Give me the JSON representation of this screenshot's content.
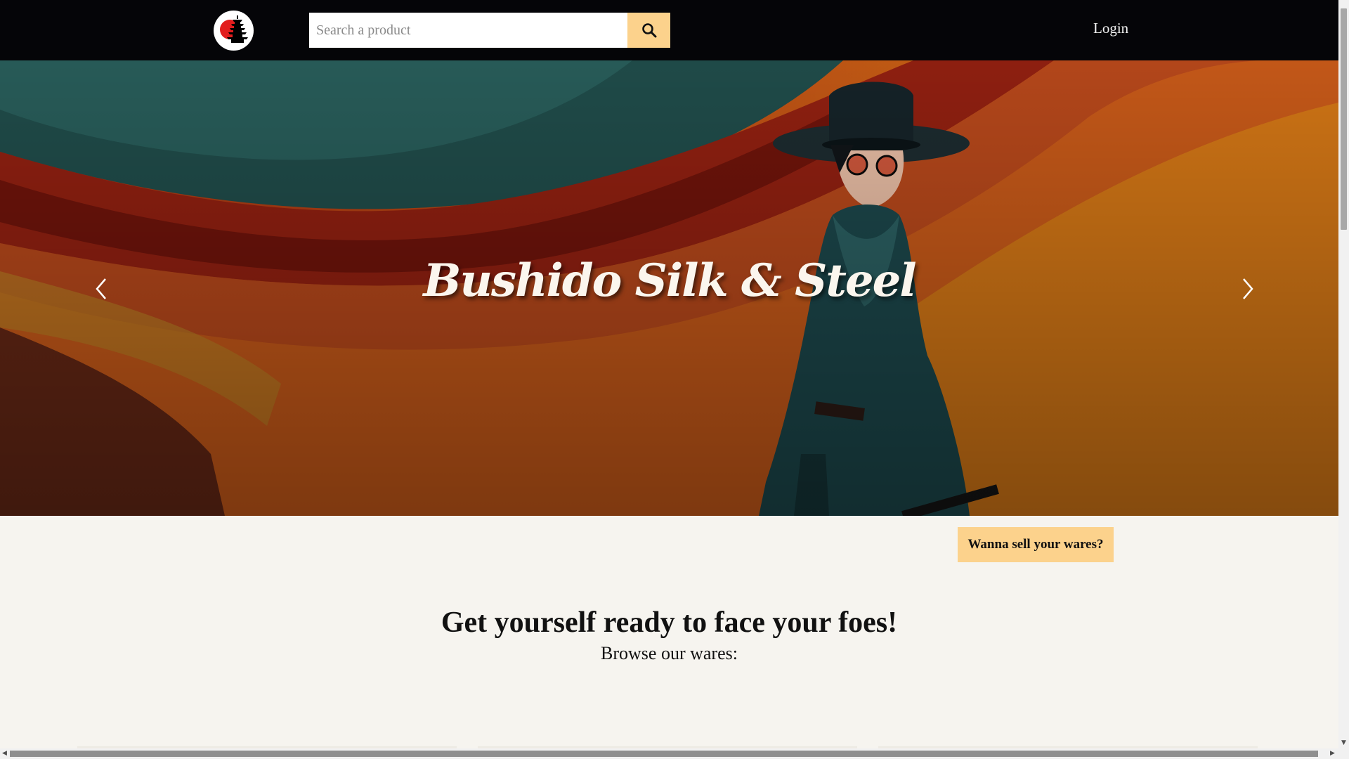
{
  "header": {
    "logo_name": "pagoda-sun-logo",
    "search": {
      "placeholder": "Search a product",
      "value": ""
    },
    "login_label": "Login"
  },
  "hero": {
    "title": "Bushido Silk & Steel"
  },
  "actions": {
    "sell_label": "Wanna sell your wares?"
  },
  "main": {
    "heading": "Get yourself ready to face your foes!",
    "subheading": "Browse our wares:"
  },
  "colors": {
    "header_bg": "#050508",
    "accent": "#fcd28c",
    "page_bg": "#f6f4ef"
  }
}
